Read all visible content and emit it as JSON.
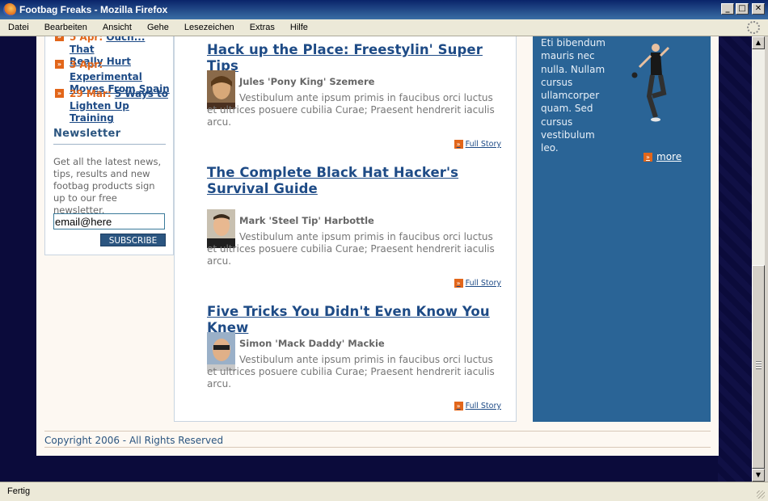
{
  "window": {
    "title": "Footbag Freaks - Mozilla Firefox",
    "minimize_label": "_",
    "maximize_label": "□",
    "close_label": "✕"
  },
  "menu": {
    "items": [
      "Datei",
      "Bearbeiten",
      "Ansicht",
      "Gehe",
      "Lesezeichen",
      "Extras",
      "Hilfe"
    ]
  },
  "sidebar": {
    "events": [
      {
        "date": "5 Apr:",
        "title_line1": "Ouch... That",
        "title_line2": "Really Hurt"
      },
      {
        "date": "3 Apr:",
        "title_line1": "Experimental",
        "title_line2": "Moves From Spain"
      },
      {
        "date": "29 Mar:",
        "title_line1": "5 Ways to",
        "title_line2": "Lighten Up Training"
      }
    ],
    "newsletter_title": "Newsletter",
    "newsletter_text": "Get all the latest news, tips, results and new footbag products sign up to our free newsletter.",
    "email_value": "email@here",
    "subscribe_label": "SUBSCRIBE"
  },
  "articles": [
    {
      "title": "Hack up the Place: Freestylin' Super Tips",
      "author": "Jules 'Pony King' Szemere",
      "body": "Vestibulum ante ipsum primis in faucibus orci luctus et ultrices posuere cubilia Curae; Praesent hendrerit iaculis arcu.",
      "more_label": "Full Story"
    },
    {
      "title": "The Complete Black Hat Hacker's Survival Guide",
      "author": "Mark 'Steel Tip' Harbottle",
      "body": "Vestibulum ante ipsum primis in faucibus orci luctus et ultrices posuere cubilia Curae; Praesent hendrerit iaculis arcu.",
      "more_label": "Full Story"
    },
    {
      "title": "Five Tricks You Didn't Even Know You Knew",
      "author": "Simon 'Mack Daddy' Mackie",
      "body": "Vestibulum ante ipsum primis in faucibus orci luctus et ultrices posuere cubilia Curae; Praesent hendrerit iaculis arcu.",
      "more_label": "Full Story"
    }
  ],
  "right_panel": {
    "text": "Eti bibendum mauris nec nulla. Nullam cursus ullamcorper quam. Sed cursus vestibulum leo.",
    "more_label": "more"
  },
  "footer": {
    "copyright": "Copyright 2006 - All Rights Reserved"
  },
  "status": {
    "text": "Fertig"
  },
  "colors": {
    "accent_orange": "#e2661a",
    "link_blue": "#1e4b86",
    "panel_blue": "#2a6496",
    "page_bg_navy": "#0b0b3b"
  }
}
